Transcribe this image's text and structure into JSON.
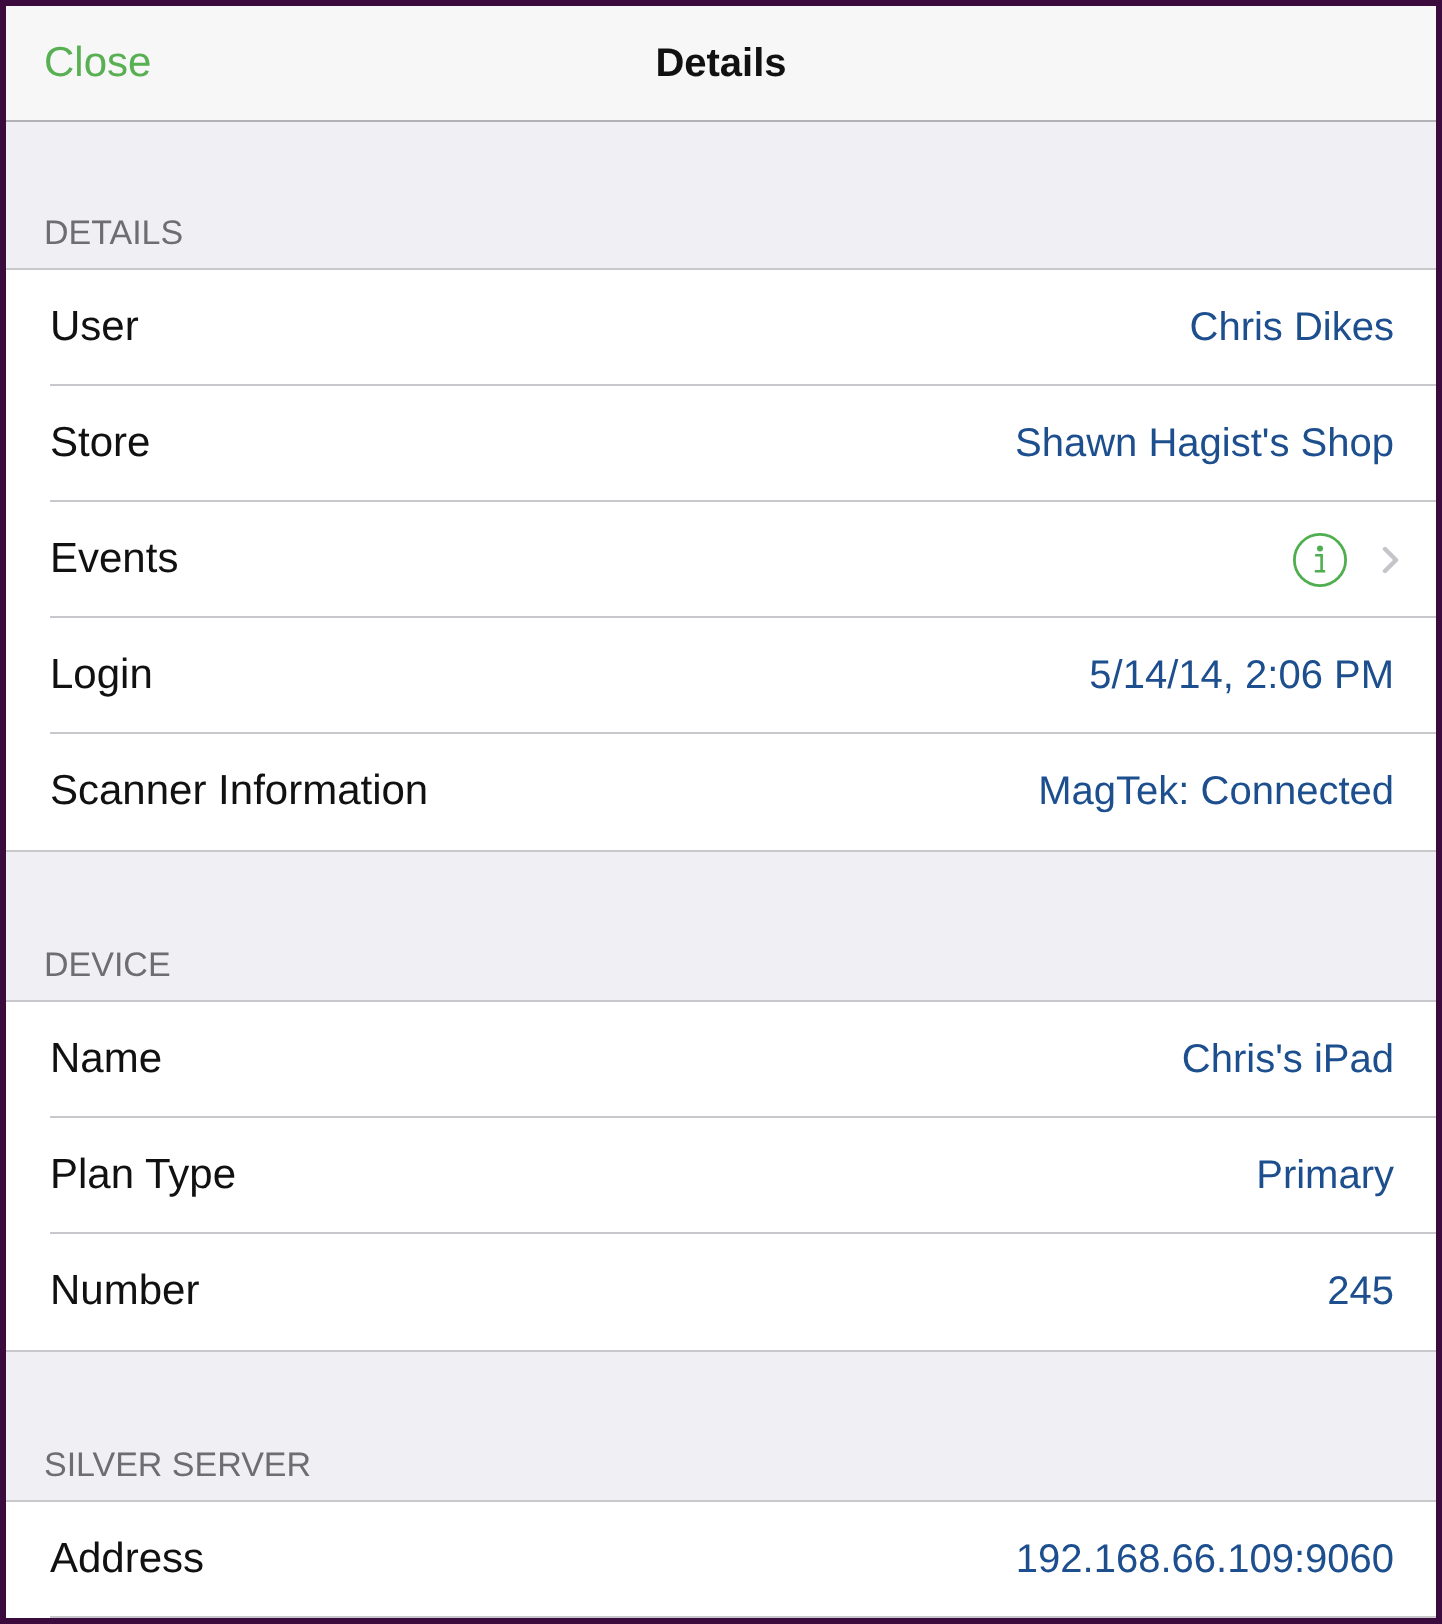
{
  "nav": {
    "close": "Close",
    "title": "Details"
  },
  "sections": [
    {
      "header": "DETAILS",
      "rows": [
        {
          "kind": "value",
          "label": "User",
          "value": "Chris Dikes"
        },
        {
          "kind": "value",
          "label": "Store",
          "value": "Shawn Hagist's Shop"
        },
        {
          "kind": "info",
          "label": "Events"
        },
        {
          "kind": "value",
          "label": "Login",
          "value": "5/14/14, 2:06 PM"
        },
        {
          "kind": "value",
          "label": "Scanner Information",
          "value": "MagTek: Connected"
        }
      ]
    },
    {
      "header": "DEVICE",
      "rows": [
        {
          "kind": "value",
          "label": "Name",
          "value": "Chris's iPad"
        },
        {
          "kind": "value",
          "label": "Plan Type",
          "value": "Primary"
        },
        {
          "kind": "value",
          "label": "Number",
          "value": "245"
        }
      ]
    },
    {
      "header": "SILVER SERVER",
      "rows": [
        {
          "kind": "value",
          "label": "Address",
          "value": "192.168.66.109:9060"
        }
      ]
    }
  ]
}
